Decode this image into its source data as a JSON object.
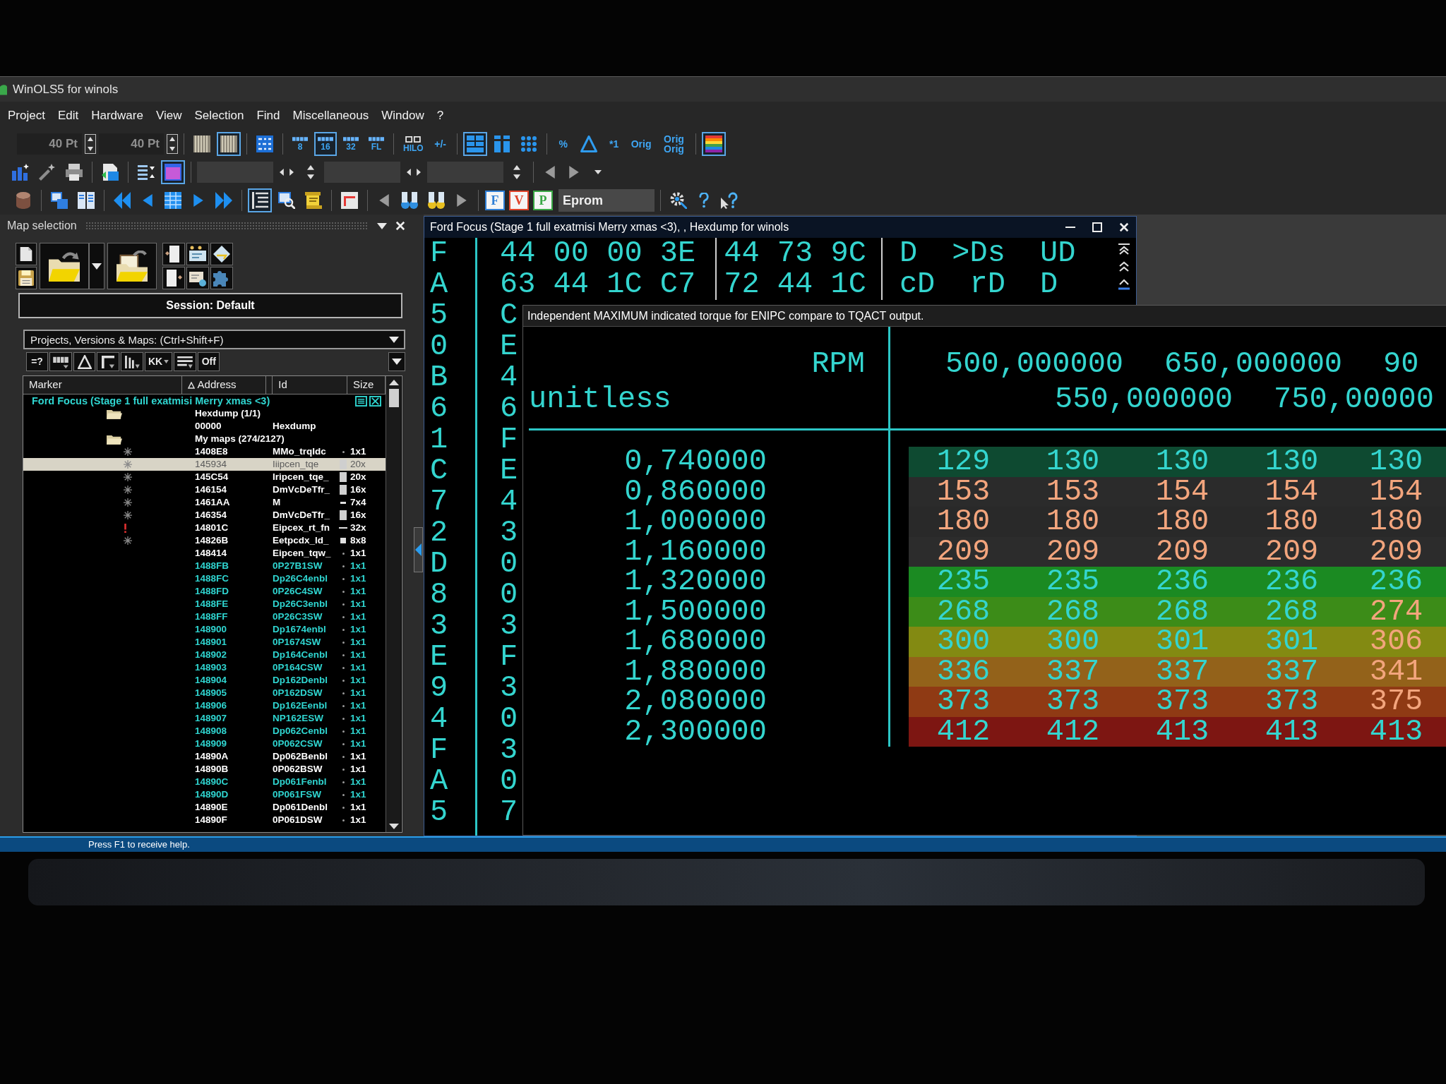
{
  "window": {
    "title": "WinOLS5 for winols"
  },
  "menu": [
    "Project",
    "Edit",
    "Hardware",
    "View",
    "Selection",
    "Find",
    "Miscellaneous",
    "Window",
    "?"
  ],
  "toolbars": [
    [
      [
        {
          "kind": "spin",
          "value": "40 Pt"
        },
        {
          "kind": "spin",
          "value": "40 Pt"
        }
      ],
      [
        {
          "kind": "button",
          "selected": false
        },
        {
          "kind": "button",
          "selected": true
        }
      ],
      [
        {
          "kind": "button",
          "selected": false
        }
      ],
      [
        {
          "kind": "button",
          "label": "8",
          "selected": false
        },
        {
          "kind": "button",
          "label": "16",
          "selected": true
        },
        {
          "kind": "button",
          "label": "32",
          "selected": false
        },
        {
          "kind": "button",
          "label": "FL",
          "selected": false
        }
      ],
      [
        {
          "kind": "button",
          "label": "HILO",
          "selected": false
        },
        {
          "kind": "button",
          "label": "+/-",
          "selected": false
        }
      ],
      [
        {
          "kind": "button",
          "selected": true
        },
        {
          "kind": "button",
          "selected": false
        },
        {
          "kind": "button",
          "selected": false
        }
      ],
      [
        {
          "kind": "button",
          "label": "%",
          "selected": false
        },
        {
          "kind": "button",
          "selected": false
        },
        {
          "kind": "button",
          "label": "*1",
          "selected": false
        },
        {
          "kind": "button",
          "label": "Orig",
          "selected": false
        },
        {
          "kind": "button",
          "label": "Orig Orig",
          "selected": false
        }
      ],
      [
        {
          "kind": "button",
          "selected": true
        }
      ]
    ],
    [
      [
        {
          "kind": "button",
          "selected": false
        },
        {
          "kind": "button",
          "selected": false
        },
        {
          "kind": "button",
          "selected": false
        }
      ],
      [
        {
          "kind": "button",
          "selected": false
        }
      ],
      [
        {
          "kind": "button",
          "selected": false
        },
        {
          "kind": "button",
          "selected": true
        }
      ],
      [
        {
          "kind": "field"
        },
        {
          "kind": "button",
          "selected": false
        },
        {
          "kind": "button",
          "selected": false
        },
        {
          "kind": "field"
        },
        {
          "kind": "button",
          "selected": false
        },
        {
          "kind": "field"
        },
        {
          "kind": "button",
          "selected": false
        }
      ],
      [
        {
          "kind": "button",
          "selected": false
        },
        {
          "kind": "button",
          "selected": false
        },
        {
          "kind": "button",
          "selected": false
        }
      ]
    ],
    [
      [
        {
          "kind": "button",
          "selected": false
        }
      ],
      [
        {
          "kind": "button",
          "selected": false
        },
        {
          "kind": "button",
          "selected": false
        }
      ],
      [
        {
          "kind": "button",
          "selected": false
        },
        {
          "kind": "button",
          "selected": false
        },
        {
          "kind": "button",
          "selected": false
        },
        {
          "kind": "button",
          "selected": false
        },
        {
          "kind": "button",
          "selected": false
        }
      ],
      [
        {
          "kind": "button",
          "selected": true
        },
        {
          "kind": "button",
          "selected": false
        },
        {
          "kind": "button",
          "selected": false
        }
      ],
      [
        {
          "kind": "button",
          "selected": false
        }
      ],
      [
        {
          "kind": "button",
          "selected": false
        },
        {
          "kind": "button",
          "selected": false
        },
        {
          "kind": "button",
          "selected": false
        },
        {
          "kind": "button",
          "selected": false
        }
      ],
      [
        {
          "kind": "button",
          "label": "F",
          "color": "#2f7fd6",
          "selected": false
        },
        {
          "kind": "button",
          "label": "V",
          "color": "#e0442a",
          "selected": false
        },
        {
          "kind": "button",
          "label": "P",
          "color": "#3aa845",
          "selected": false
        },
        {
          "kind": "field",
          "value": "Eprom"
        }
      ],
      [
        {
          "kind": "button",
          "selected": false
        },
        {
          "kind": "button",
          "selected": false
        },
        {
          "kind": "button",
          "selected": false
        }
      ]
    ]
  ],
  "map_selection": {
    "title": "Map selection",
    "session": "Session: Default",
    "search": {
      "placeholder": "Projects, Versions & Maps: (Ctrl+Shift+F)"
    },
    "filter_buttons": [
      {
        "label": "=?",
        "selected": false
      },
      {
        "selected": false
      },
      {
        "selected": false
      },
      {
        "selected": false
      },
      {
        "selected": false
      },
      {
        "label": "KK",
        "selected": false
      },
      {
        "selected": false
      },
      {
        "label": "Off",
        "selected": false
      }
    ],
    "columns": [
      {
        "label": "Marker",
        "sorted": false
      },
      {
        "label": "Address",
        "sorted": true
      },
      {
        "label": "Id",
        "sorted": false
      },
      {
        "label": "Size",
        "sorted": false
      }
    ],
    "rows": [
      {
        "kind": "project",
        "label": "Ford Focus (Stage 1 full exatmisi Merry xmas <3)",
        "selected": false
      },
      {
        "kind": "folder",
        "label": "Hexdump (1/1)",
        "selected": false
      },
      {
        "kind": "map",
        "address": "00000",
        "id": "Hexdump",
        "color": "#ffffff",
        "marked": false,
        "warning": false,
        "selected": false
      },
      {
        "kind": "folder",
        "label": "My maps (274/2127)",
        "selected": false
      },
      {
        "kind": "map",
        "address": "1408E8",
        "id": "MMo_trqIdc",
        "preview": {
          "kind": "dot"
        },
        "size": "1x1",
        "color": "#ffffff",
        "marked": true,
        "warning": false,
        "selected": false
      },
      {
        "kind": "map",
        "address": "145934",
        "id": "Iiipcen_tqe",
        "preview": {
          "kind": "tile"
        },
        "size": "20x",
        "marked": true,
        "warning": false,
        "selected": true
      },
      {
        "kind": "map",
        "address": "145C54",
        "id": "Iripcen_tqe_",
        "preview": {
          "kind": "tile"
        },
        "size": "20x",
        "color": "#ffffff",
        "marked": true,
        "warning": false,
        "selected": false
      },
      {
        "kind": "map",
        "address": "146154",
        "id": "DmVcDeTfr_",
        "preview": {
          "kind": "tile"
        },
        "size": "16x",
        "color": "#ffffff",
        "marked": true,
        "warning": false,
        "selected": false
      },
      {
        "kind": "map",
        "address": "1461AA",
        "id": "M",
        "preview": {
          "kind": "dash"
        },
        "size": "7x4",
        "color": "#ffffff",
        "marked": true,
        "warning": false,
        "selected": false
      },
      {
        "kind": "map",
        "address": "146354",
        "id": "DmVcDeTfr_",
        "preview": {
          "kind": "tile"
        },
        "size": "16x",
        "color": "#ffffff",
        "marked": true,
        "warning": false,
        "selected": false
      },
      {
        "kind": "map",
        "address": "14801C",
        "id": "Eipcex_rt_fn",
        "preview": {
          "kind": "line"
        },
        "size": "32x",
        "color": "#ffffff",
        "marked": false,
        "warning": true,
        "selected": false
      },
      {
        "kind": "map",
        "address": "14826B",
        "id": "Eetpcdx_ld_",
        "preview": {
          "kind": "square"
        },
        "size": "8x8",
        "color": "#ffffff",
        "marked": true,
        "warning": false,
        "selected": false
      },
      {
        "kind": "map",
        "address": "148414",
        "id": "Eipcen_tqw_",
        "preview": {
          "kind": "dot"
        },
        "size": "1x1",
        "color": "#ffffff",
        "marked": false,
        "warning": false,
        "selected": false
      },
      {
        "kind": "map",
        "address": "1488FB",
        "id": "0P27B1SW",
        "preview": {
          "kind": "dot"
        },
        "size": "1x1",
        "color": "#2fd5d0",
        "marked": false,
        "warning": false,
        "selected": false
      },
      {
        "kind": "map",
        "address": "1488FC",
        "id": "Dp26C4enbl",
        "preview": {
          "kind": "dot"
        },
        "size": "1x1",
        "color": "#2fd5d0",
        "marked": false,
        "warning": false,
        "selected": false
      },
      {
        "kind": "map",
        "address": "1488FD",
        "id": "0P26C4SW",
        "preview": {
          "kind": "dot"
        },
        "size": "1x1",
        "color": "#2fd5d0",
        "marked": false,
        "warning": false,
        "selected": false
      },
      {
        "kind": "map",
        "address": "1488FE",
        "id": "Dp26C3enbl",
        "preview": {
          "kind": "dot"
        },
        "size": "1x1",
        "color": "#2fd5d0",
        "marked": false,
        "warning": false,
        "selected": false
      },
      {
        "kind": "map",
        "address": "1488FF",
        "id": "0P26C3SW",
        "preview": {
          "kind": "dot"
        },
        "size": "1x1",
        "color": "#2fd5d0",
        "marked": false,
        "warning": false,
        "selected": false
      },
      {
        "kind": "map",
        "address": "148900",
        "id": "Dp1674enbl",
        "preview": {
          "kind": "dot"
        },
        "size": "1x1",
        "color": "#2fd5d0",
        "marked": false,
        "warning": false,
        "selected": false
      },
      {
        "kind": "map",
        "address": "148901",
        "id": "0P1674SW",
        "preview": {
          "kind": "dot"
        },
        "size": "1x1",
        "color": "#2fd5d0",
        "marked": false,
        "warning": false,
        "selected": false
      },
      {
        "kind": "map",
        "address": "148902",
        "id": "Dp164Cenbl",
        "preview": {
          "kind": "dot"
        },
        "size": "1x1",
        "color": "#2fd5d0",
        "marked": false,
        "warning": false,
        "selected": false
      },
      {
        "kind": "map",
        "address": "148903",
        "id": "0P164CSW",
        "preview": {
          "kind": "dot"
        },
        "size": "1x1",
        "color": "#2fd5d0",
        "marked": false,
        "warning": false,
        "selected": false
      },
      {
        "kind": "map",
        "address": "148904",
        "id": "Dp162Denbl",
        "preview": {
          "kind": "dot"
        },
        "size": "1x1",
        "color": "#2fd5d0",
        "marked": false,
        "warning": false,
        "selected": false
      },
      {
        "kind": "map",
        "address": "148905",
        "id": "0P162DSW",
        "preview": {
          "kind": "dot"
        },
        "size": "1x1",
        "color": "#2fd5d0",
        "marked": false,
        "warning": false,
        "selected": false
      },
      {
        "kind": "map",
        "address": "148906",
        "id": "Dp162Eenbl",
        "preview": {
          "kind": "dot"
        },
        "size": "1x1",
        "color": "#2fd5d0",
        "marked": false,
        "warning": false,
        "selected": false
      },
      {
        "kind": "map",
        "address": "148907",
        "id": "NP162ESW",
        "preview": {
          "kind": "dot"
        },
        "size": "1x1",
        "color": "#2fd5d0",
        "marked": false,
        "warning": false,
        "selected": false
      },
      {
        "kind": "map",
        "address": "148908",
        "id": "Dp062Cenbl",
        "preview": {
          "kind": "dot"
        },
        "size": "1x1",
        "color": "#2fd5d0",
        "marked": false,
        "warning": false,
        "selected": false
      },
      {
        "kind": "map",
        "address": "148909",
        "id": "0P062CSW",
        "preview": {
          "kind": "dot"
        },
        "size": "1x1",
        "color": "#2fd5d0",
        "marked": false,
        "warning": false,
        "selected": false
      },
      {
        "kind": "map",
        "address": "14890A",
        "id": "Dp062Benbl",
        "preview": {
          "kind": "dot"
        },
        "size": "1x1",
        "color": "#ffffff",
        "marked": false,
        "warning": false,
        "selected": false
      },
      {
        "kind": "map",
        "address": "14890B",
        "id": "0P062BSW",
        "preview": {
          "kind": "dot"
        },
        "size": "1x1",
        "color": "#ffffff",
        "marked": false,
        "warning": false,
        "selected": false
      },
      {
        "kind": "map",
        "address": "14890C",
        "id": "Dp061Fenbl",
        "preview": {
          "kind": "dot"
        },
        "size": "1x1",
        "color": "#2fd5d0",
        "marked": false,
        "warning": false,
        "selected": false
      },
      {
        "kind": "map",
        "address": "14890D",
        "id": "0P061FSW",
        "preview": {
          "kind": "dot"
        },
        "size": "1x1",
        "color": "#2fd5d0",
        "marked": false,
        "warning": false,
        "selected": false
      },
      {
        "kind": "map",
        "address": "14890E",
        "id": "Dp061Denbl",
        "preview": {
          "kind": "dot"
        },
        "size": "1x1",
        "color": "#ffffff",
        "marked": false,
        "warning": false,
        "selected": false
      },
      {
        "kind": "map",
        "address": "14890F",
        "id": "0P061DSW",
        "preview": {
          "kind": "dot"
        },
        "size": "1x1",
        "color": "#ffffff",
        "marked": false,
        "warning": false,
        "selected": false
      }
    ]
  },
  "hexdump_window": {
    "title": "Ford Focus (Stage 1 full exatmisi Merry xmas <3), , Hexdump for winols",
    "rows": [
      {
        "column_1": "F",
        "column_2": "44 00 00 3E",
        "column_3": "44 73 9C",
        "column_4": "D >Ds UD"
      },
      {
        "column_1": "A",
        "column_2": "63 44 1C C7",
        "column_3": "72 44 1C",
        "column_4": "cD rD D"
      },
      {
        "column_1": "5",
        "column_2": "C"
      },
      {
        "column_1": "0",
        "column_2": "E"
      },
      {
        "column_1": "B",
        "column_2": "4"
      },
      {
        "column_1": "6",
        "column_2": "6"
      },
      {
        "column_1": "1",
        "column_2": "F"
      },
      {
        "column_1": "C",
        "column_2": "E"
      },
      {
        "column_1": "7",
        "column_2": "4"
      },
      {
        "column_1": "2",
        "column_2": "3"
      },
      {
        "column_1": "D",
        "column_2": "0"
      },
      {
        "column_1": "8",
        "column_2": "0"
      },
      {
        "column_1": "3",
        "column_2": "3"
      },
      {
        "column_1": "E",
        "column_2": "F"
      },
      {
        "column_1": "9",
        "column_2": "3"
      },
      {
        "column_1": "4",
        "column_2": "0"
      },
      {
        "column_1": "F",
        "column_2": "3"
      },
      {
        "column_1": "A",
        "column_2": "0"
      },
      {
        "column_1": "5",
        "column_2": "7"
      }
    ]
  },
  "map_window": {
    "title": "Independent MAXIMUM indicated torque for ENIPC compare to TQACT output.",
    "column_axis_unit": "RPM",
    "row_axis_unit": "unitless",
    "columns": [
      "500,000000",
      "550,000000",
      "650,000000",
      "750,00000",
      "90"
    ],
    "rows": [
      {
        "label": "0,740000",
        "color": "#0e4a31",
        "cells": [
          {
            "value": "129",
            "highlighted": false
          },
          {
            "value": "130",
            "highlighted": false
          },
          {
            "value": "130",
            "highlighted": false
          },
          {
            "value": "130",
            "highlighted": false
          },
          {
            "value": "130",
            "highlighted": false
          }
        ]
      },
      {
        "label": "0,860000",
        "color": "#2b2b2b",
        "cells": [
          {
            "value": "153",
            "highlighted": true
          },
          {
            "value": "153",
            "highlighted": true
          },
          {
            "value": "154",
            "highlighted": true
          },
          {
            "value": "154",
            "highlighted": true
          },
          {
            "value": "154",
            "highlighted": true
          }
        ]
      },
      {
        "label": "1,000000",
        "color": "#292929",
        "cells": [
          {
            "value": "180",
            "highlighted": true
          },
          {
            "value": "180",
            "highlighted": true
          },
          {
            "value": "180",
            "highlighted": true
          },
          {
            "value": "180",
            "highlighted": true
          },
          {
            "value": "180",
            "highlighted": true
          }
        ]
      },
      {
        "label": "1,160000",
        "color": "#2c2c2c",
        "cells": [
          {
            "value": "209",
            "highlighted": true
          },
          {
            "value": "209",
            "highlighted": true
          },
          {
            "value": "209",
            "highlighted": true
          },
          {
            "value": "209",
            "highlighted": true
          },
          {
            "value": "209",
            "highlighted": true
          }
        ]
      },
      {
        "label": "1,320000",
        "color": "#1b8a22",
        "cells": [
          {
            "value": "235",
            "highlighted": false
          },
          {
            "value": "235",
            "highlighted": false
          },
          {
            "value": "236",
            "highlighted": false
          },
          {
            "value": "236",
            "highlighted": false
          },
          {
            "value": "236",
            "highlighted": false
          }
        ]
      },
      {
        "label": "1,500000",
        "color": "#3c8c18",
        "cells": [
          {
            "value": "268",
            "highlighted": false
          },
          {
            "value": "268",
            "highlighted": false
          },
          {
            "value": "268",
            "highlighted": false
          },
          {
            "value": "268",
            "highlighted": false
          },
          {
            "value": "274",
            "highlighted": true
          }
        ]
      },
      {
        "label": "1,680000",
        "color": "#838a12",
        "cells": [
          {
            "value": "300",
            "highlighted": false
          },
          {
            "value": "300",
            "highlighted": false
          },
          {
            "value": "301",
            "highlighted": false
          },
          {
            "value": "301",
            "highlighted": false
          },
          {
            "value": "306",
            "highlighted": true
          }
        ]
      },
      {
        "label": "1,880000",
        "color": "#93621a",
        "cells": [
          {
            "value": "336",
            "highlighted": false
          },
          {
            "value": "337",
            "highlighted": false
          },
          {
            "value": "337",
            "highlighted": false
          },
          {
            "value": "337",
            "highlighted": false
          },
          {
            "value": "341",
            "highlighted": true
          }
        ]
      },
      {
        "label": "2,080000",
        "color": "#8f3a14",
        "cells": [
          {
            "value": "373",
            "highlighted": false
          },
          {
            "value": "373",
            "highlighted": false
          },
          {
            "value": "373",
            "highlighted": false
          },
          {
            "value": "373",
            "highlighted": false
          },
          {
            "value": "375",
            "highlighted": true
          }
        ]
      },
      {
        "label": "2,300000",
        "color": "#7d1612",
        "cells": [
          {
            "value": "412",
            "highlighted": false
          },
          {
            "value": "412",
            "highlighted": false
          },
          {
            "value": "413",
            "highlighted": false
          },
          {
            "value": "413",
            "highlighted": false
          },
          {
            "value": "413",
            "highlighted": false
          }
        ]
      }
    ]
  },
  "status_bar": "Press F1 to receive help."
}
